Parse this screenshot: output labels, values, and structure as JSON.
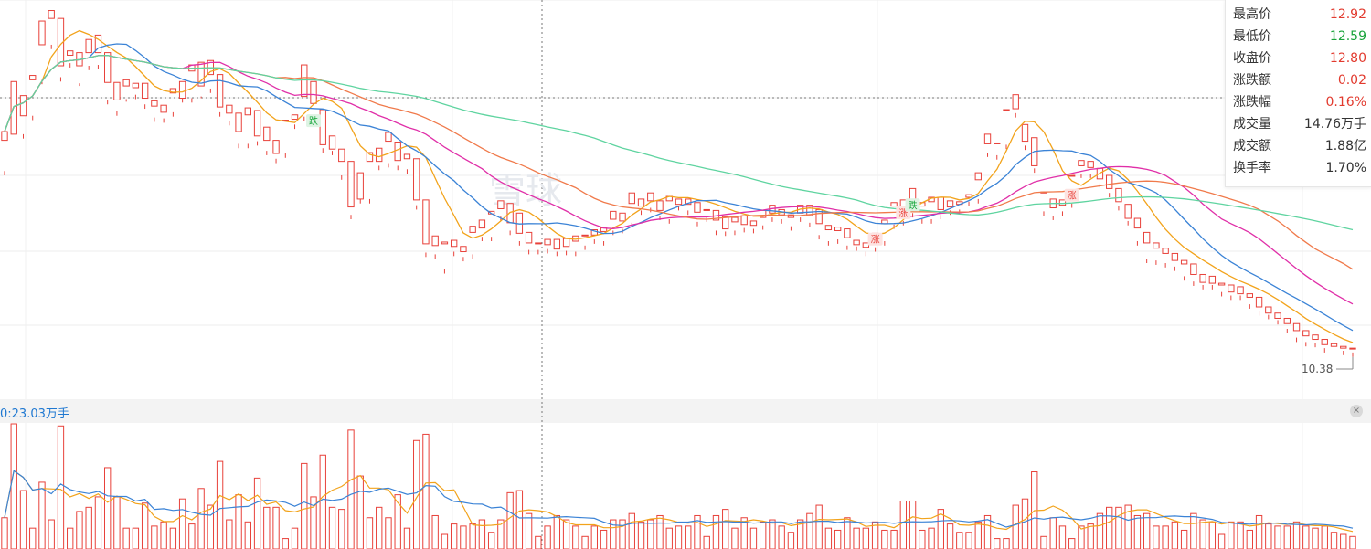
{
  "info_panel": {
    "rows": [
      {
        "label": "最高价",
        "value": "12.92",
        "color": "#e23a2e"
      },
      {
        "label": "最低价",
        "value": "12.59",
        "color": "#19a33a"
      },
      {
        "label": "收盘价",
        "value": "12.80",
        "color": "#e23a2e"
      },
      {
        "label": "涨跌额",
        "value": "0.02",
        "color": "#e23a2e"
      },
      {
        "label": "涨跌幅",
        "value": "0.16%",
        "color": "#e23a2e"
      },
      {
        "label": "成交量",
        "value": "14.76万手",
        "color": "#333333"
      },
      {
        "label": "成交额",
        "value": "1.88亿",
        "color": "#333333"
      },
      {
        "label": "换手率",
        "value": "1.70%",
        "color": "#333333"
      }
    ]
  },
  "watermark": "雪球",
  "volume_label": "0:23.03万手",
  "close_icon": "×",
  "colors": {
    "up": "#e8413a",
    "down": "#13a538",
    "ma5": "#f2a31b",
    "ma10": "#3b83d6",
    "ma20": "#e02fa8",
    "ma30": "#f07a4b",
    "ma60": "#5fd4a0"
  },
  "chart_data": {
    "type": "candlestick",
    "low_label": "10.38",
    "markers": [
      {
        "index": 33,
        "text": "跌",
        "kind": "down"
      },
      {
        "index": 93,
        "text": "涨",
        "kind": "up"
      },
      {
        "index": 96,
        "text": "涨",
        "kind": "up"
      },
      {
        "index": 97,
        "text": "跌",
        "kind": "down"
      },
      {
        "index": 114,
        "text": "涨",
        "kind": "up"
      }
    ],
    "volume_labels": [],
    "candles": [
      [
        12.95,
        13.05,
        12.6,
        12.55
      ],
      [
        13.02,
        13.62,
        12.62,
        12.62
      ],
      [
        13.23,
        13.46,
        13.02,
        12.97
      ],
      [
        13.64,
        13.69,
        13.23,
        13.18
      ],
      [
        14.04,
        14.31,
        13.64,
        13.59
      ],
      [
        14.34,
        14.43,
        14.04,
        13.99
      ],
      [
        13.8,
        14.34,
        13.67,
        13.62
      ],
      [
        13.92,
        13.97,
        13.83,
        13.78
      ],
      [
        13.8,
        13.95,
        13.6,
        13.57
      ],
      [
        13.95,
        14.1,
        13.8,
        13.75
      ],
      [
        13.95,
        14.15,
        13.81,
        13.76
      ],
      [
        13.61,
        13.95,
        13.41,
        13.36
      ],
      [
        13.41,
        13.61,
        13.28,
        13.23
      ],
      [
        13.57,
        13.64,
        13.42,
        13.39
      ],
      [
        13.55,
        13.6,
        13.47,
        13.42
      ],
      [
        13.43,
        13.6,
        13.36,
        13.31
      ],
      [
        13.34,
        13.4,
        13.21,
        13.16
      ],
      [
        13.27,
        13.35,
        13.2,
        13.15
      ],
      [
        13.49,
        13.54,
        13.27,
        13.22
      ],
      [
        13.43,
        13.62,
        13.43,
        13.38
      ],
      [
        13.74,
        13.81,
        13.43,
        13.38
      ],
      [
        13.57,
        13.84,
        13.45,
        13.43
      ],
      [
        13.7,
        13.86,
        13.54,
        13.49
      ],
      [
        13.33,
        13.7,
        13.27,
        13.22
      ],
      [
        13.26,
        13.35,
        13.17,
        13.12
      ],
      [
        13.05,
        13.26,
        12.91,
        12.86
      ],
      [
        13.24,
        13.32,
        12.91,
        12.86
      ],
      [
        13.0,
        13.29,
        12.94,
        12.89
      ],
      [
        12.95,
        13.1,
        12.83,
        12.78
      ],
      [
        12.8,
        12.95,
        12.74,
        12.69
      ],
      [
        13.18,
        13.18,
        12.8,
        12.75
      ],
      [
        13.19,
        13.24,
        13.13,
        13.08
      ],
      [
        13.45,
        13.81,
        13.22,
        13.17
      ],
      [
        13.37,
        13.62,
        13.08,
        13.08
      ],
      [
        12.9,
        13.3,
        12.86,
        12.81
      ],
      [
        12.85,
        13.0,
        12.83,
        12.78
      ],
      [
        12.71,
        12.85,
        12.55,
        12.5
      ],
      [
        12.19,
        12.71,
        12.1,
        12.05
      ],
      [
        12.28,
        12.58,
        12.28,
        12.23
      ],
      [
        12.71,
        12.81,
        12.28,
        12.23
      ],
      [
        12.71,
        12.86,
        12.66,
        12.61
      ],
      [
        12.94,
        13.04,
        12.69,
        12.64
      ],
      [
        12.72,
        12.93,
        12.66,
        12.61
      ],
      [
        12.74,
        12.79,
        12.62,
        12.57
      ],
      [
        12.27,
        12.74,
        12.21,
        12.16
      ],
      [
        11.77,
        12.27,
        11.67,
        11.62
      ],
      [
        11.75,
        11.86,
        11.65,
        11.6
      ],
      [
        11.77,
        11.79,
        11.48,
        11.43
      ],
      [
        11.74,
        11.81,
        11.68,
        11.63
      ],
      [
        11.68,
        11.74,
        11.62,
        11.57
      ],
      [
        11.9,
        11.97,
        11.65,
        11.6
      ],
      [
        11.95,
        12.04,
        11.85,
        11.8
      ],
      [
        12.11,
        12.14,
        11.85,
        11.8
      ],
      [
        12.17,
        12.26,
        12.08,
        12.03
      ],
      [
        12.01,
        12.23,
        11.92,
        11.87
      ],
      [
        11.89,
        12.12,
        11.8,
        11.75
      ],
      [
        11.78,
        11.9,
        11.7,
        11.65
      ],
      [
        11.77,
        11.78,
        11.7,
        11.65
      ],
      [
        11.76,
        11.82,
        11.71,
        11.66
      ],
      [
        11.71,
        11.82,
        11.68,
        11.63
      ],
      [
        11.74,
        11.83,
        11.69,
        11.64
      ],
      [
        11.8,
        11.86,
        11.68,
        11.63
      ],
      [
        11.86,
        11.87,
        11.75,
        11.7
      ],
      [
        11.87,
        11.93,
        11.82,
        11.77
      ],
      [
        11.91,
        11.95,
        11.8,
        11.75
      ],
      [
        12.05,
        12.14,
        11.92,
        11.87
      ],
      [
        12.03,
        12.12,
        11.94,
        11.89
      ],
      [
        12.23,
        12.35,
        12.01,
        11.96
      ],
      [
        12.2,
        12.28,
        12.15,
        12.1
      ],
      [
        12.26,
        12.35,
        12.18,
        12.13
      ],
      [
        12.15,
        12.26,
        12.09,
        12.04
      ],
      [
        12.26,
        12.31,
        12.05,
        12.0
      ],
      [
        12.22,
        12.28,
        12.2,
        12.15
      ],
      [
        12.22,
        12.28,
        12.15,
        12.1
      ],
      [
        12.13,
        12.24,
        12.02,
        11.97
      ],
      [
        12.15,
        12.16,
        12.07,
        12.02
      ],
      [
        12.04,
        12.15,
        11.92,
        11.87
      ],
      [
        11.94,
        12.08,
        11.91,
        11.86
      ],
      [
        12.02,
        12.07,
        11.92,
        11.87
      ],
      [
        11.99,
        12.09,
        11.95,
        11.9
      ],
      [
        11.98,
        12.03,
        11.94,
        11.89
      ],
      [
        12.07,
        12.15,
        11.98,
        11.93
      ],
      [
        12.12,
        12.21,
        12.07,
        12.02
      ],
      [
        12.1,
        12.16,
        12.05,
        12.0
      ],
      [
        12.07,
        12.1,
        11.97,
        11.92
      ],
      [
        12.12,
        12.21,
        12.07,
        12.02
      ],
      [
        12.09,
        12.21,
        12.01,
        11.96
      ],
      [
        12.0,
        12.16,
        11.87,
        11.82
      ],
      [
        11.93,
        11.98,
        11.8,
        11.75
      ],
      [
        11.92,
        11.96,
        11.82,
        11.77
      ],
      [
        11.84,
        11.94,
        11.75,
        11.7
      ],
      [
        11.76,
        11.81,
        11.74,
        11.69
      ],
      [
        11.73,
        11.78,
        11.68,
        11.63
      ],
      [
        11.81,
        11.89,
        11.73,
        11.68
      ],
      [
        12.0,
        12.04,
        11.8,
        11.75
      ],
      [
        12.2,
        12.24,
        11.99,
        11.94
      ],
      [
        12.09,
        12.27,
        12.03,
        11.98
      ],
      [
        12.22,
        12.4,
        12.12,
        12.07
      ],
      [
        12.2,
        12.24,
        12.05,
        12.0
      ],
      [
        12.25,
        12.3,
        12.05,
        12.0
      ],
      [
        12.16,
        12.3,
        12.1,
        12.05
      ],
      [
        12.19,
        12.26,
        12.15,
        12.1
      ],
      [
        12.22,
        12.25,
        12.16,
        12.11
      ],
      [
        12.3,
        12.33,
        12.25,
        12.2
      ],
      [
        12.5,
        12.58,
        12.28,
        12.23
      ],
      [
        12.91,
        13.02,
        12.81,
        12.76
      ],
      [
        12.92,
        12.92,
        12.78,
        12.73
      ],
      [
        13.3,
        13.3,
        12.9,
        12.85
      ],
      [
        13.31,
        13.47,
        13.26,
        13.21
      ],
      [
        12.94,
        13.13,
        12.89,
        12.84
      ],
      [
        12.66,
        12.98,
        12.63,
        12.58
      ],
      [
        12.35,
        12.36,
        12.14,
        12.09
      ],
      [
        12.18,
        12.28,
        12.09,
        12.04
      ],
      [
        12.21,
        12.27,
        12.14,
        12.09
      ],
      [
        12.55,
        12.55,
        12.23,
        12.18
      ],
      [
        12.66,
        12.72,
        12.57,
        12.52
      ],
      [
        12.64,
        12.71,
        12.57,
        12.52
      ],
      [
        12.51,
        12.63,
        12.46,
        12.41
      ],
      [
        12.4,
        12.55,
        12.35,
        12.3
      ],
      [
        12.25,
        12.4,
        12.2,
        12.15
      ],
      [
        12.06,
        12.22,
        12.03,
        11.98
      ],
      [
        11.95,
        12.06,
        11.8,
        11.75
      ],
      [
        11.78,
        11.9,
        11.6,
        11.55
      ],
      [
        11.72,
        11.78,
        11.58,
        11.53
      ],
      [
        11.66,
        11.72,
        11.55,
        11.5
      ],
      [
        11.58,
        11.66,
        11.51,
        11.46
      ],
      [
        11.54,
        11.58,
        11.4,
        11.35
      ],
      [
        11.42,
        11.54,
        11.34,
        11.29
      ],
      [
        11.33,
        11.42,
        11.3,
        11.25
      ],
      [
        11.32,
        11.4,
        11.3,
        11.25
      ],
      [
        11.3,
        11.32,
        11.22,
        11.17
      ],
      [
        11.22,
        11.3,
        11.18,
        11.13
      ],
      [
        11.2,
        11.28,
        11.18,
        11.13
      ],
      [
        11.16,
        11.2,
        11.08,
        11.03
      ],
      [
        11.05,
        11.16,
        11.0,
        10.95
      ],
      [
        10.98,
        11.05,
        10.96,
        10.91
      ],
      [
        10.92,
        10.98,
        10.9,
        10.85
      ],
      [
        10.86,
        10.92,
        10.8,
        10.75
      ],
      [
        10.78,
        10.86,
        10.7,
        10.65
      ],
      [
        10.72,
        10.78,
        10.65,
        10.6
      ],
      [
        10.68,
        10.73,
        10.64,
        10.59
      ],
      [
        10.62,
        10.68,
        10.58,
        10.53
      ],
      [
        10.6,
        10.63,
        10.55,
        10.5
      ],
      [
        10.58,
        10.6,
        10.55,
        10.5
      ],
      [
        10.57,
        10.58,
        10.53,
        10.48
      ]
    ]
  }
}
